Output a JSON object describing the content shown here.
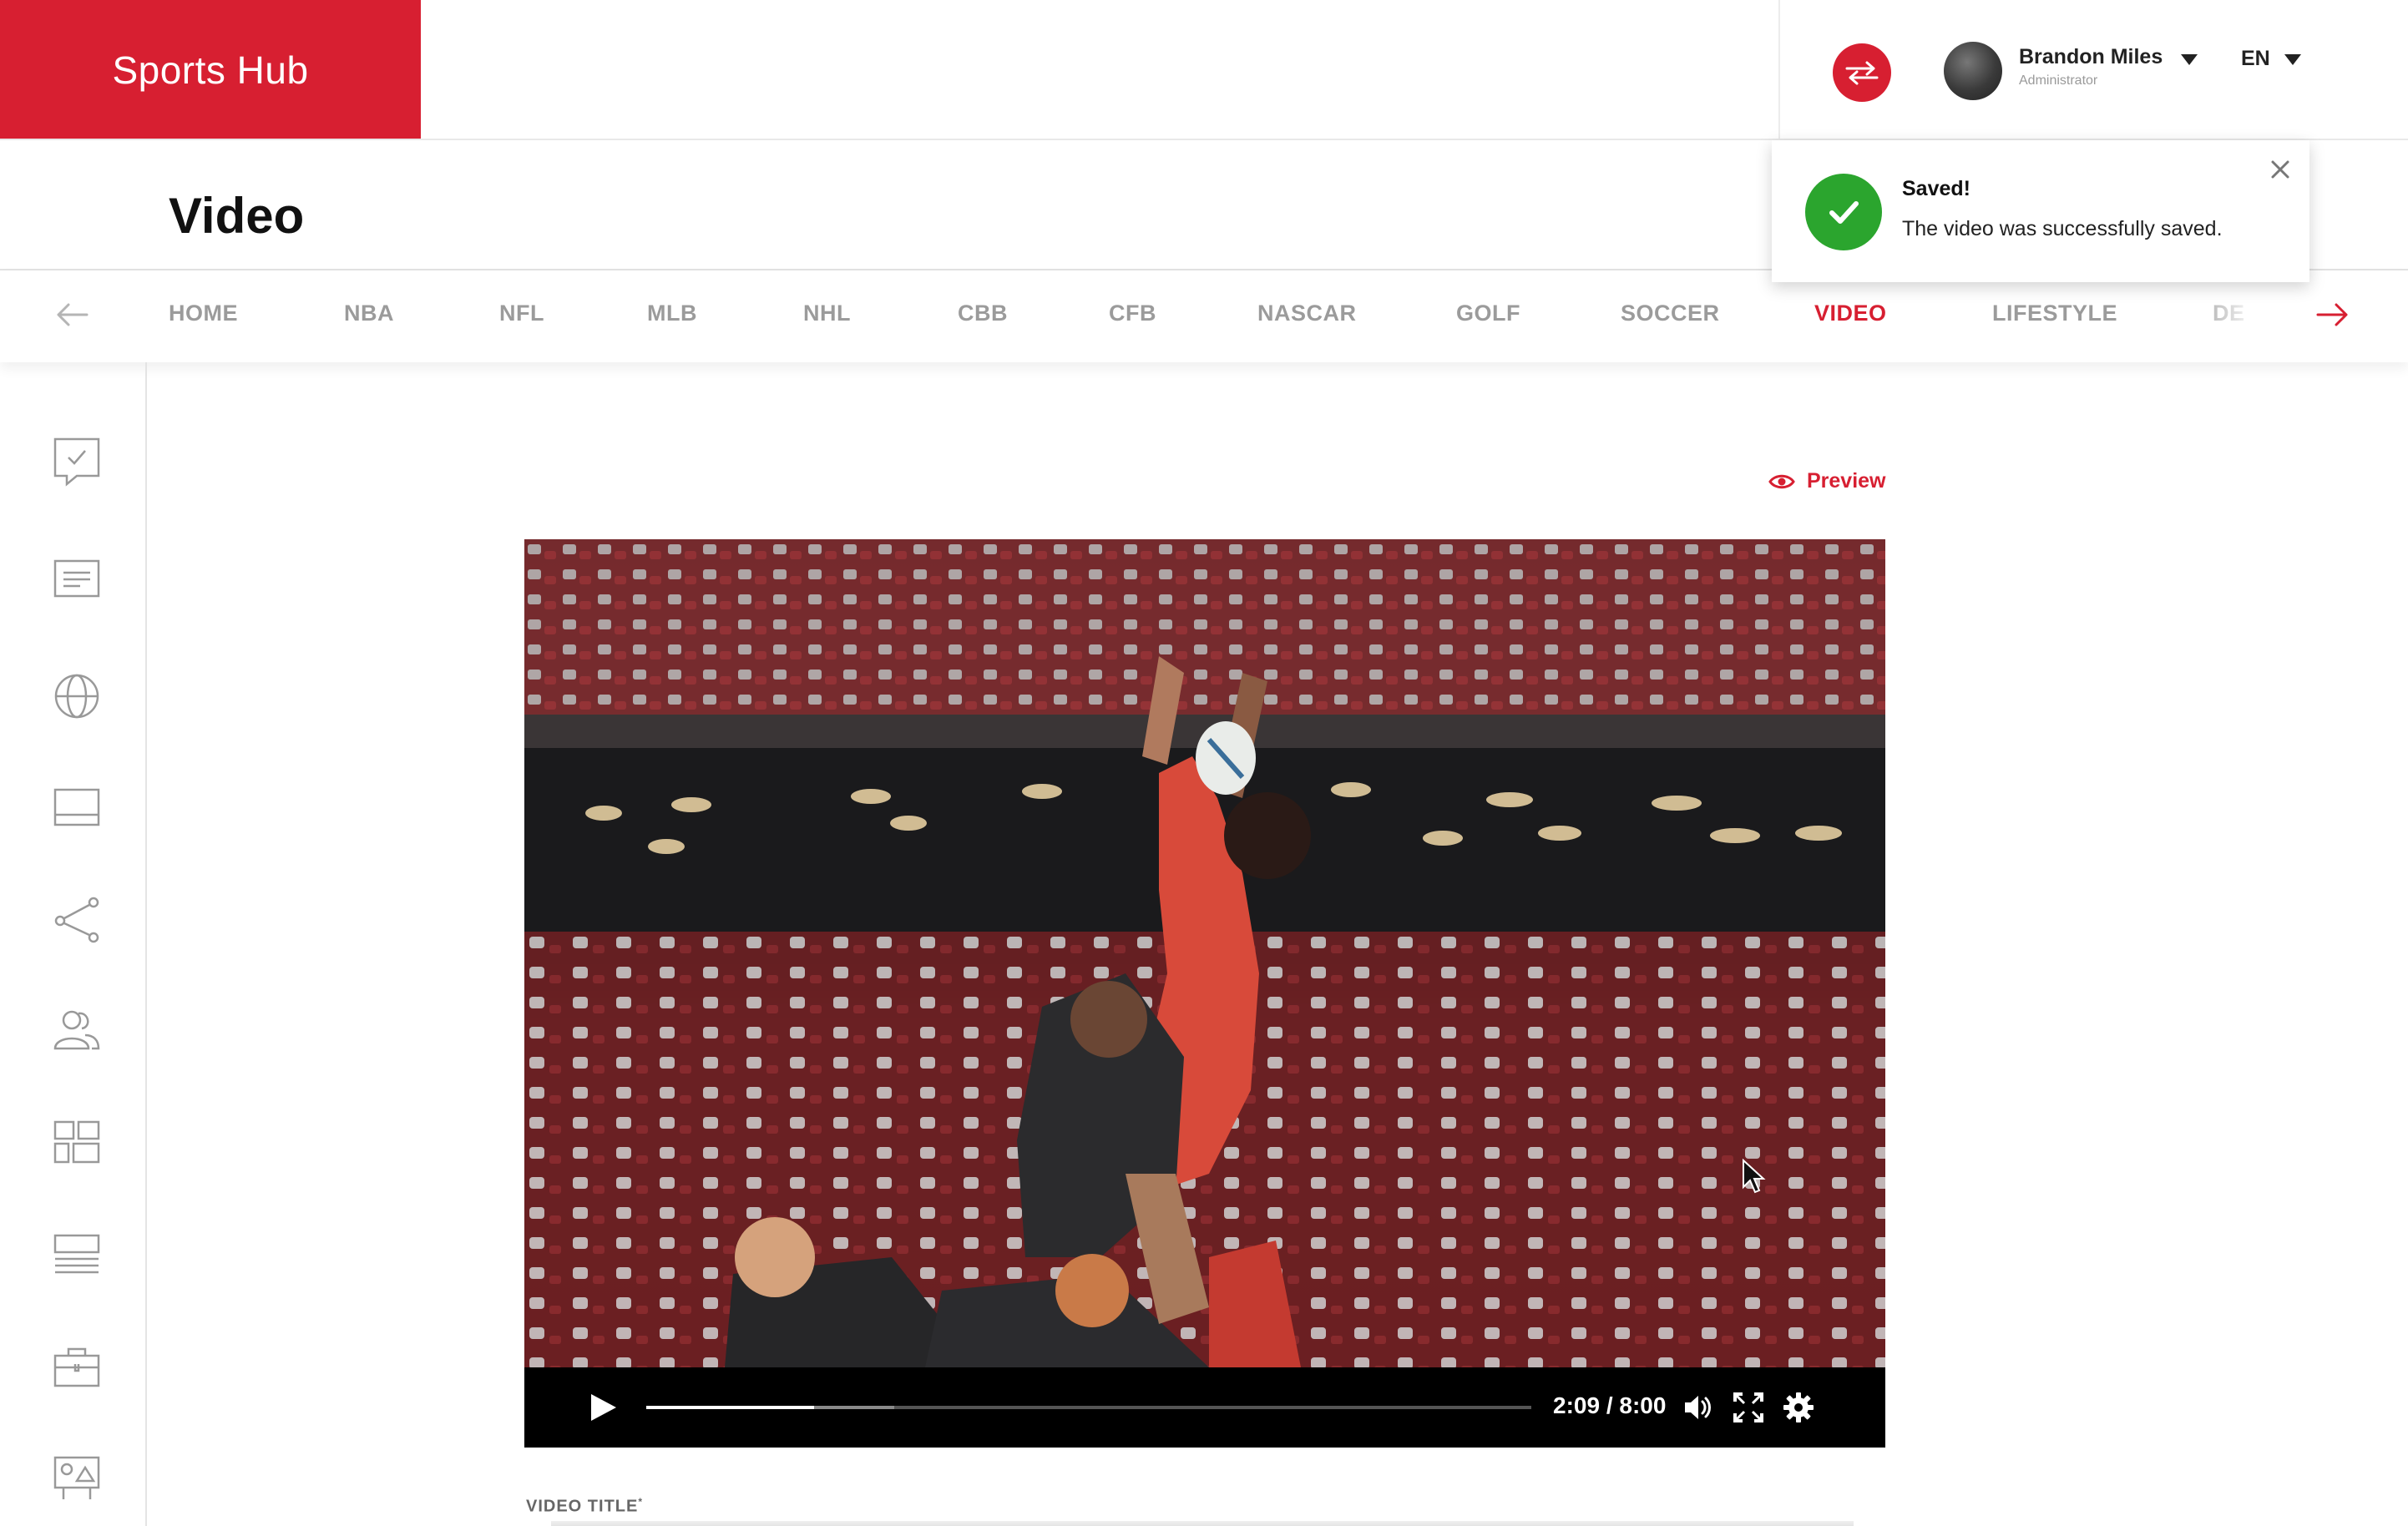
{
  "header": {
    "brand": "Sports Hub",
    "user": {
      "name": "Brandon Miles",
      "role": "Administrator"
    },
    "language": "EN"
  },
  "page": {
    "title": "Video"
  },
  "nav": {
    "items": [
      {
        "label": "HOME",
        "active": false
      },
      {
        "label": "NBA",
        "active": false
      },
      {
        "label": "NFL",
        "active": false
      },
      {
        "label": "MLB",
        "active": false
      },
      {
        "label": "NHL",
        "active": false
      },
      {
        "label": "CBB",
        "active": false
      },
      {
        "label": "CFB",
        "active": false
      },
      {
        "label": "NASCAR",
        "active": false
      },
      {
        "label": "GOLF",
        "active": false
      },
      {
        "label": "SOCCER",
        "active": false
      },
      {
        "label": "VIDEO",
        "active": true
      },
      {
        "label": "LIFESTYLE",
        "active": false
      },
      {
        "label": "DE",
        "active": false
      }
    ]
  },
  "toast": {
    "title": "Saved!",
    "message": "The video was successfully saved."
  },
  "sidebar": {
    "icons": [
      "chat-check-icon",
      "document-lines-icon",
      "globe-icon",
      "panel-icon",
      "share-icon",
      "users-icon",
      "layout-icon",
      "list-icon",
      "briefcase-icon",
      "image-board-icon"
    ]
  },
  "main": {
    "preview_label": "Preview",
    "video": {
      "current_time": "2:09",
      "duration": "8:00",
      "time_display": "2:09 / 8:00",
      "progress_fraction": 0.19,
      "buffered_fraction": 0.28
    },
    "video_title_label": "VIDEO TITLE",
    "required_mark": "*"
  },
  "colors": {
    "brand_red": "#d71f31",
    "success_green": "#2ba52e",
    "nav_inactive": "#9b9b9b"
  }
}
